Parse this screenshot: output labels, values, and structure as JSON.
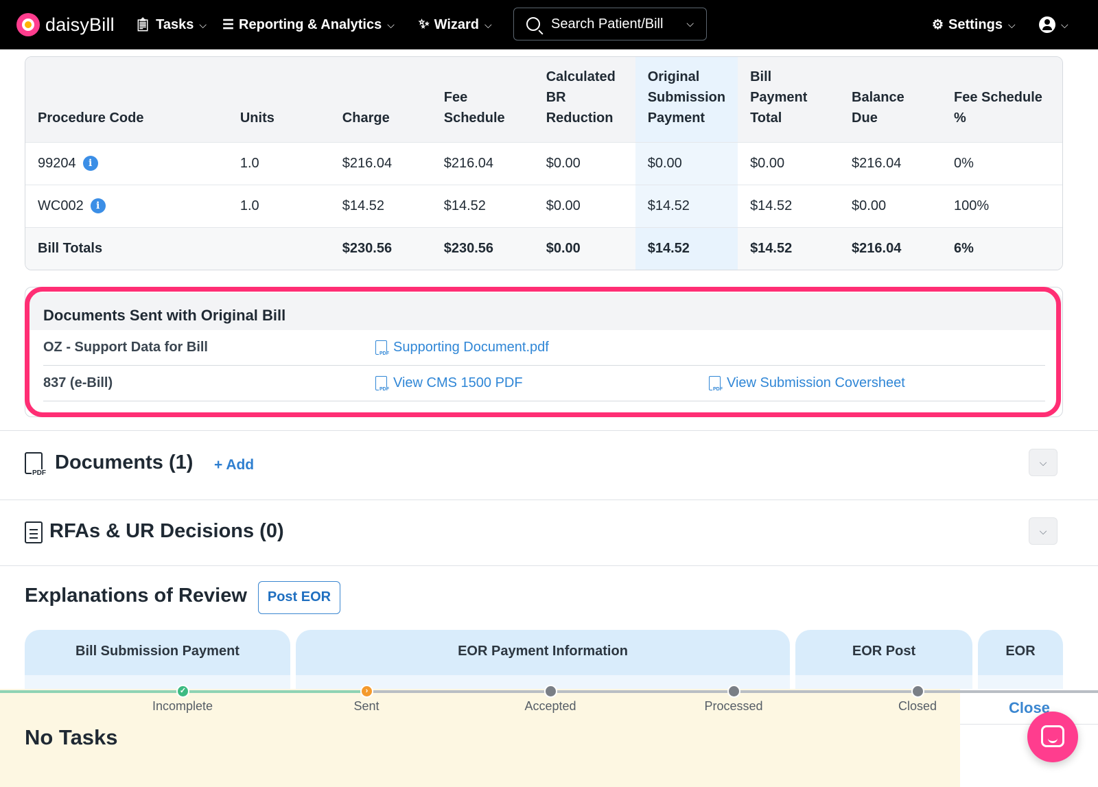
{
  "nav": {
    "brand": "daisyBill",
    "tasks": "Tasks",
    "reporting": "Reporting & Analytics",
    "wizard": "Wizard",
    "search_placeholder": "Search Patient/Bill",
    "settings": "Settings"
  },
  "procedure_table": {
    "headers": {
      "code": "Procedure Code",
      "units": "Units",
      "charge": "Charge",
      "fee_schedule": "Fee Schedule",
      "br_reduction": "Calculated BR Reduction",
      "original_payment": "Original Submission Payment",
      "bill_payment_total": "Bill Payment Total",
      "balance_due": "Balance Due",
      "fee_schedule_pct": "Fee Schedule %"
    },
    "rows": [
      {
        "code": "99204",
        "units": "1.0",
        "charge": "$216.04",
        "fee_schedule": "$216.04",
        "br_reduction": "$0.00",
        "original_payment": "$0.00",
        "bill_payment_total": "$0.00",
        "balance_due": "$216.04",
        "fee_schedule_pct": "0%"
      },
      {
        "code": "WC002",
        "units": "1.0",
        "charge": "$14.52",
        "fee_schedule": "$14.52",
        "br_reduction": "$0.00",
        "original_payment": "$14.52",
        "bill_payment_total": "$14.52",
        "balance_due": "$0.00",
        "fee_schedule_pct": "100%"
      }
    ],
    "totals": {
      "label": "Bill Totals",
      "charge": "$230.56",
      "fee_schedule": "$230.56",
      "br_reduction": "$0.00",
      "original_payment": "$14.52",
      "bill_payment_total": "$14.52",
      "balance_due": "$216.04",
      "fee_schedule_pct": "6%"
    }
  },
  "docs_sent": {
    "title": "Documents Sent with Original Bill",
    "rows": [
      {
        "label": "OZ - Support Data for Bill",
        "link1": "Supporting Document.pdf"
      },
      {
        "label": "837 (e-Bill)",
        "link1": "View CMS 1500 PDF",
        "link2": "View Submission Coversheet"
      }
    ]
  },
  "documents_section": {
    "title": "Documents (1)",
    "add": "+ Add"
  },
  "rfa_section": {
    "title": "RFAs & UR Decisions (0)"
  },
  "eor_section": {
    "title": "Explanations of Review",
    "post_button": "Post EOR",
    "column_groups": [
      "Bill Submission Payment",
      "EOR Payment Information",
      "EOR Post",
      "EOR"
    ]
  },
  "status_bar": {
    "steps": [
      "Incomplete",
      "Sent",
      "Accepted",
      "Processed",
      "Closed"
    ],
    "current_step": "Sent",
    "no_tasks": "No Tasks",
    "close": "Close"
  },
  "colors": {
    "highlight_frame": "#ff2e74",
    "link": "#2f86d6",
    "accent_pink": "#ff3d8e",
    "tasks_bg": "#fdf7e2"
  }
}
